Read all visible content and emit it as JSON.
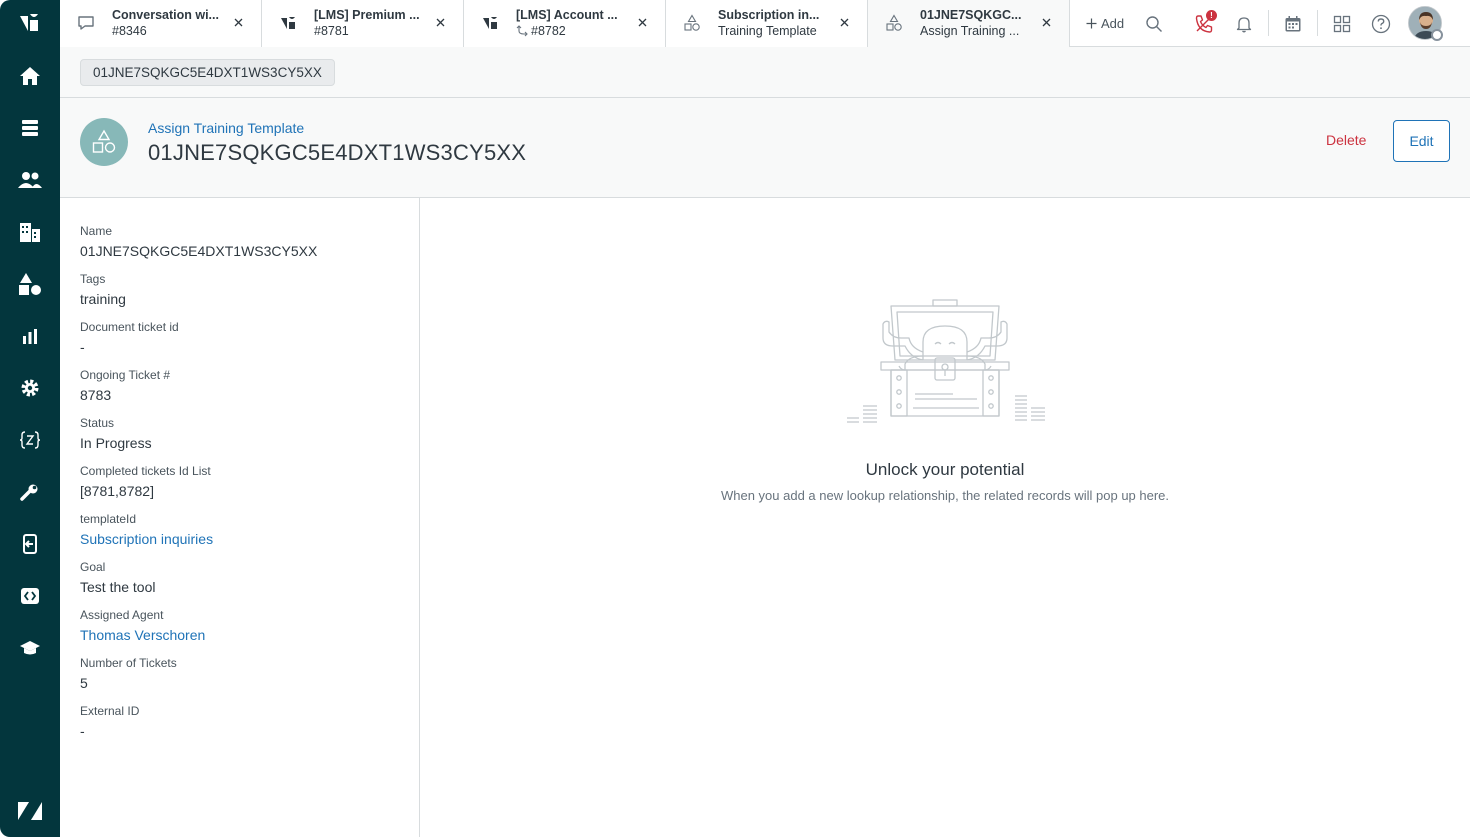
{
  "tabs": [
    {
      "title": "Conversation wi...",
      "sub": "#8346",
      "icon": "chat-bubble-icon"
    },
    {
      "title": "[LMS] Premium ...",
      "sub": "#8781",
      "icon": "ticket-icon"
    },
    {
      "title": "[LMS] Account ...",
      "sub": "#8782",
      "icon": "ticket-icon",
      "sub_icon": "merge-icon"
    },
    {
      "title": "Subscription in...",
      "sub": "Training Template",
      "icon": "shapes-icon"
    },
    {
      "title": "01JNE7SQKGC...",
      "sub": "Assign Training ...",
      "icon": "shapes-icon",
      "active": true
    }
  ],
  "topbar": {
    "add_label": "Add",
    "notification_badge": "!"
  },
  "breadcrumb": {
    "label": "01JNE7SQKGC5E4DXT1WS3CY5XX"
  },
  "header": {
    "object_type": "Assign Training Template",
    "title": "01JNE7SQKGC5E4DXT1WS3CY5XX",
    "delete_label": "Delete",
    "edit_label": "Edit"
  },
  "fields": [
    {
      "label": "Name",
      "value": "01JNE7SQKGC5E4DXT1WS3CY5XX",
      "link": false
    },
    {
      "label": "Tags",
      "value": "training",
      "link": false
    },
    {
      "label": "Document ticket id",
      "value": "-",
      "link": false
    },
    {
      "label": "Ongoing Ticket #",
      "value": "8783",
      "link": false
    },
    {
      "label": "Status",
      "value": "In Progress",
      "link": false
    },
    {
      "label": "Completed tickets Id List",
      "value": "[8781,8782]",
      "link": false
    },
    {
      "label": "templateId",
      "value": "Subscription inquiries",
      "link": true
    },
    {
      "label": "Goal",
      "value": "Test the tool",
      "link": false
    },
    {
      "label": "Assigned Agent",
      "value": "Thomas Verschoren",
      "link": true
    },
    {
      "label": "Number of Tickets",
      "value": "5",
      "link": false
    },
    {
      "label": "External ID",
      "value": "-",
      "link": false
    }
  ],
  "empty_state": {
    "title": "Unlock your potential",
    "description": "When you add a new lookup relationship, the related records will pop up here."
  },
  "colors": {
    "nav_bg": "#03363d",
    "link": "#1f73b7",
    "danger": "#cc3340",
    "object_avatar": "#87b8b8"
  }
}
